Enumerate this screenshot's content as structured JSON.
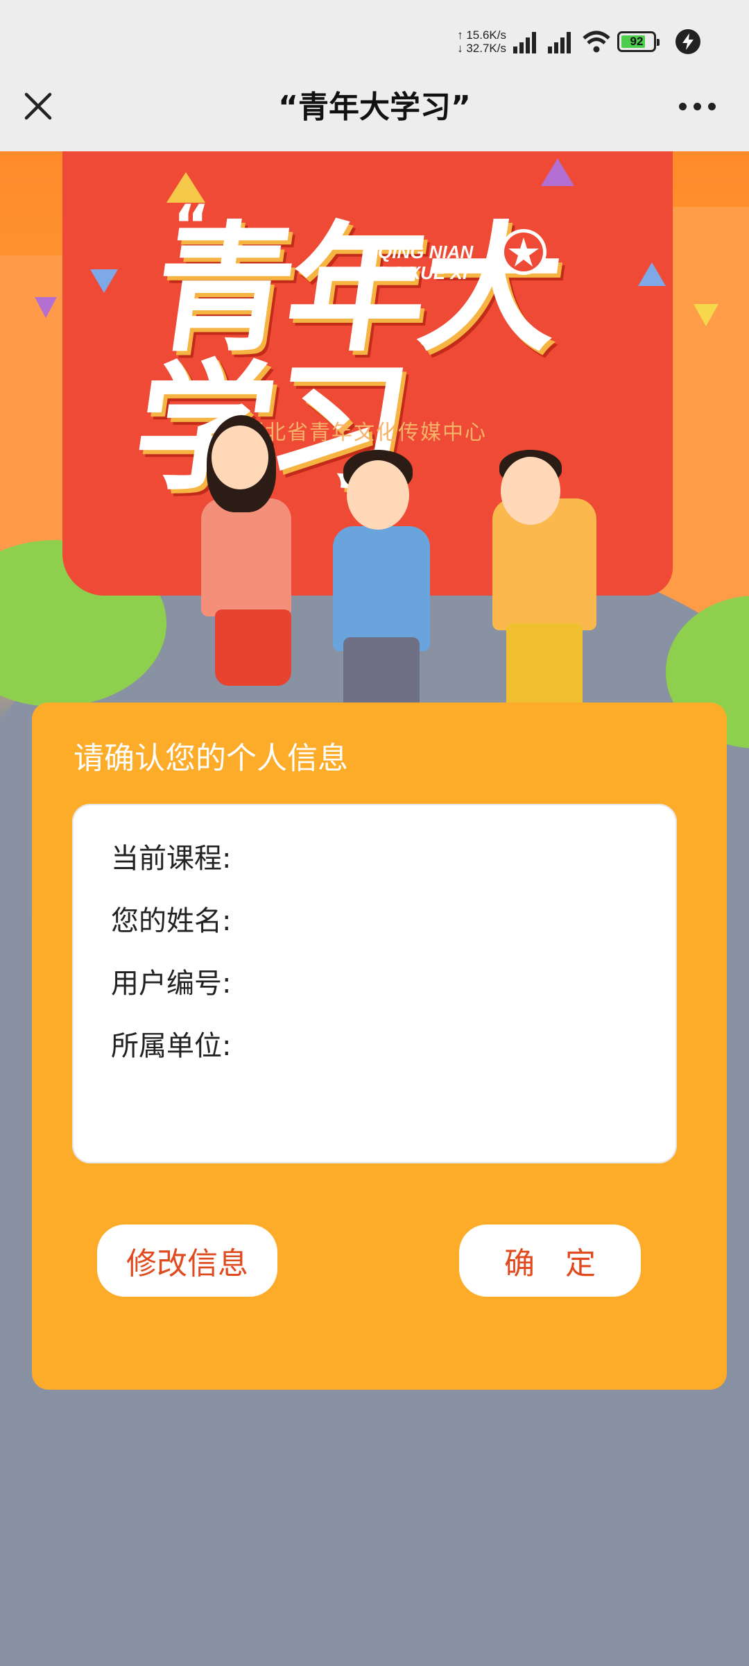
{
  "status_bar": {
    "upload_speed": "15.6K/s",
    "download_speed": "32.7K/s",
    "battery": "92"
  },
  "header": {
    "title": "“青年大学习”",
    "close_icon": "close-icon",
    "more_icon": "more-icon"
  },
  "banner": {
    "title": "青年大学习",
    "pinyin_line1": "QING NIAN",
    "pinyin_line2": "DA XUE XI",
    "subtitle": "湖北省青年文化传媒中心"
  },
  "card": {
    "title": "请确认您的个人信息",
    "fields": [
      {
        "label": "当前课程:",
        "value": ""
      },
      {
        "label": "您的姓名:",
        "value": ""
      },
      {
        "label": "用户编号:",
        "value": ""
      },
      {
        "label": "所属单位:",
        "value": ""
      }
    ],
    "edit_button": "修改信息",
    "confirm_button": "确　定"
  },
  "colors": {
    "card_bg": "#fdac2a",
    "button_text": "#e04a1f",
    "background": "#8791a1"
  }
}
